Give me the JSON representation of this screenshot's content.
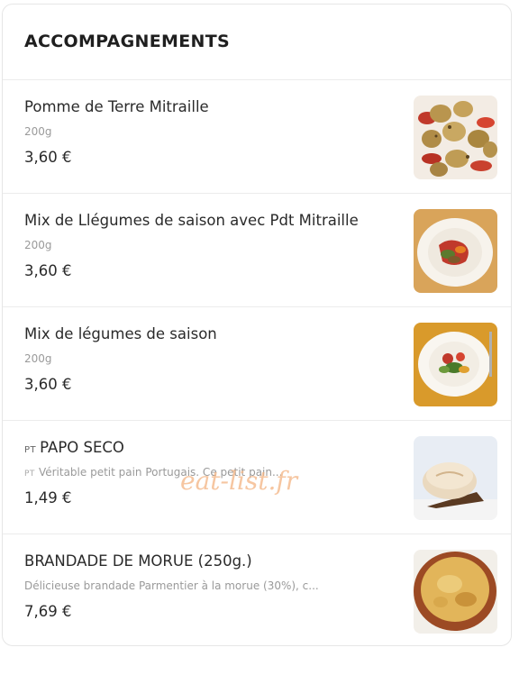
{
  "section": {
    "title": "ACCOMPAGNEMENTS"
  },
  "items": [
    {
      "name": "Pomme de Terre Mitraille",
      "flag": "",
      "description": "200g",
      "price": "3,60 €",
      "image": "potatoes-photo"
    },
    {
      "name": "Mix de Llégumes de saison avec Pdt Mitraille",
      "flag": "",
      "description": "200g",
      "price": "3,60 €",
      "image": "vegetables-potatoes-plate-photo"
    },
    {
      "name": "Mix de légumes de saison",
      "flag": "",
      "description": "200g",
      "price": "3,60 €",
      "image": "vegetables-plate-photo"
    },
    {
      "name": "PAPO SECO",
      "flag": "PT",
      "description": "Véritable petit pain Portugais. Ce petit pain...",
      "desc_flag": "PT",
      "price": "1,49 €",
      "image": "bread-roll-photo"
    },
    {
      "name": "BRANDADE DE MORUE (250g.)",
      "flag": "",
      "description": "Délicieuse brandade Parmentier à la morue (30%), c...",
      "price": "7,69 €",
      "image": "brandade-dish-photo"
    }
  ],
  "watermark": "eat-list.fr"
}
